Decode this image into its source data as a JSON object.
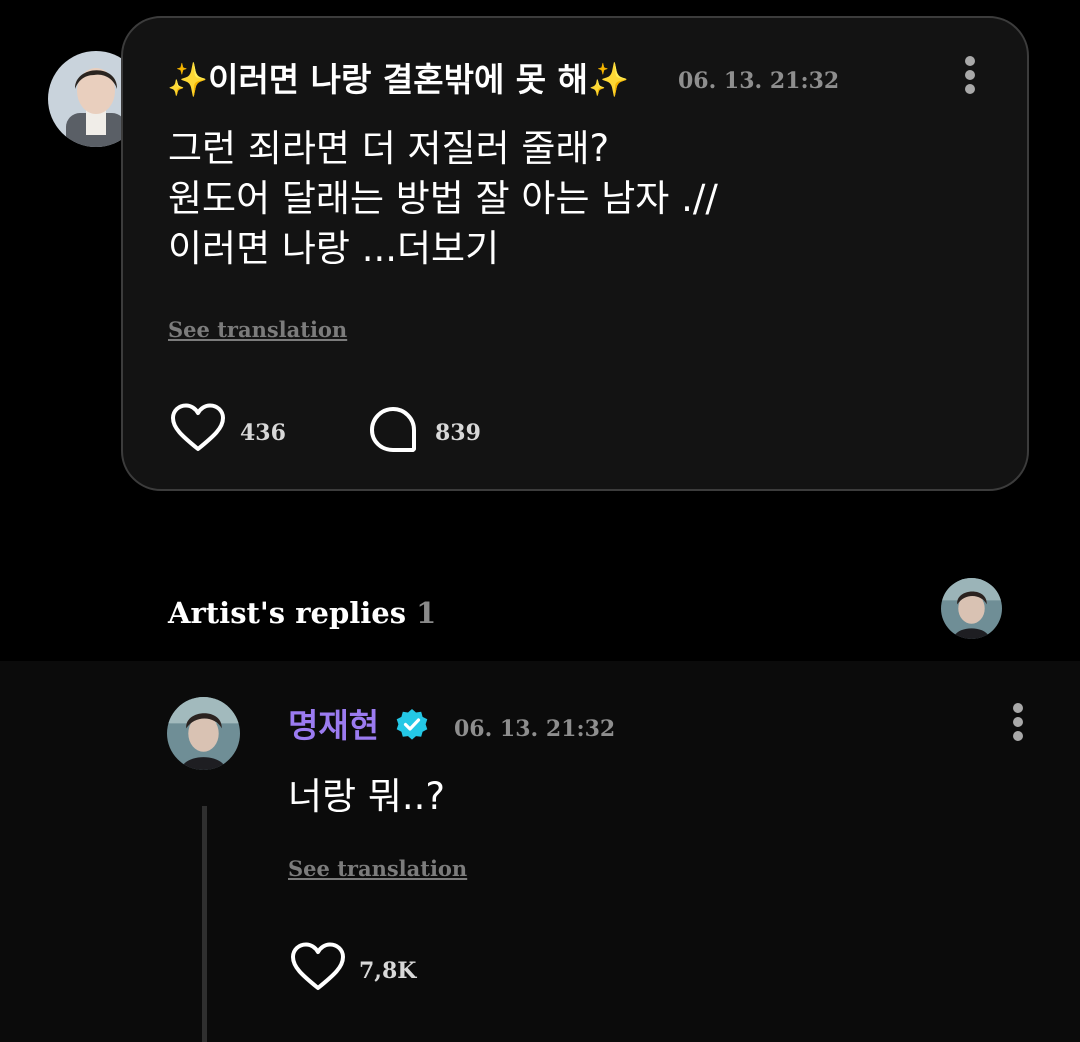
{
  "colors": {
    "background": "#000000",
    "card_background": "#131313",
    "card_border": "#3c3c3c",
    "reply_background": "#0b0b0b",
    "author_name": "#9b7bf0",
    "verified_badge": "#24c8e6",
    "muted_text": "#8e8e8e"
  },
  "post": {
    "avatar": "user-avatar",
    "title": "✨이러면 나랑 결혼밖에 못 해✨",
    "timestamp": "06. 13. 21:32",
    "more_icon": "vertical-dots-icon",
    "body": "그런 죄라면 더 저질러 줄래?\n원도어 달래는 방법 잘 아는 남자 .//\n이러면 나랑 ...더보기",
    "see_translation": "See translation",
    "likes": {
      "icon": "heart-icon",
      "count": "436"
    },
    "comments": {
      "icon": "comment-bubble-icon",
      "count": "839"
    }
  },
  "artist_replies": {
    "label": "Artist's replies",
    "count": "1",
    "avatar": "artist-avatar"
  },
  "reply": {
    "avatar": "artist-avatar",
    "author": "명재현",
    "verified_icon": "verified-badge-icon",
    "timestamp": "06. 13. 21:32",
    "more_icon": "vertical-dots-icon",
    "body": "너랑 뭐..?",
    "see_translation": "See translation",
    "likes": {
      "icon": "heart-icon",
      "count": "7,8K"
    }
  }
}
